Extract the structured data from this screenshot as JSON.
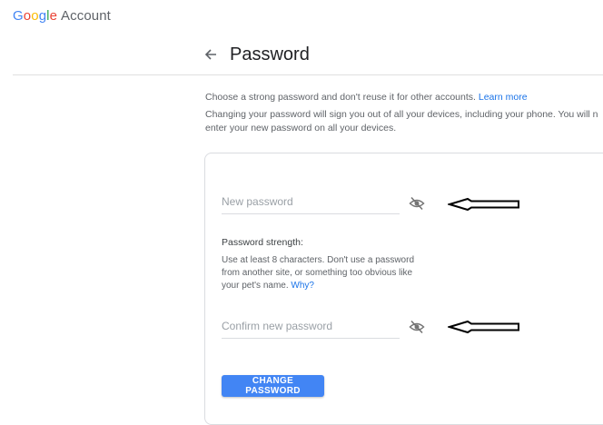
{
  "header": {
    "logo_letters": [
      "G",
      "o",
      "o",
      "g",
      "l",
      "e"
    ],
    "logo_suffix": "Account"
  },
  "page": {
    "title": "Password"
  },
  "intro": {
    "line1": "Choose a strong password and don't reuse it for other accounts.",
    "learn_more": "Learn more",
    "line2a": "Changing your password will sign you out of all your devices, including your phone. You will n",
    "line2b": "enter your new password on all your devices."
  },
  "form": {
    "new_password": {
      "placeholder": "New password",
      "value": ""
    },
    "strength_label": "Password strength:",
    "strength_help": "Use at least 8 characters. Don't use a password from another site, or something too obvious like your pet's name.",
    "strength_why": "Why?",
    "confirm_password": {
      "placeholder": "Confirm new password",
      "value": ""
    },
    "submit_label": "CHANGE PASSWORD"
  },
  "icons": {
    "back": "arrow-back-icon",
    "visibility": "visibility-off-icon",
    "annotation": "annotation-arrow"
  },
  "colors": {
    "accent": "#4285f4",
    "link": "#1a73e8"
  }
}
